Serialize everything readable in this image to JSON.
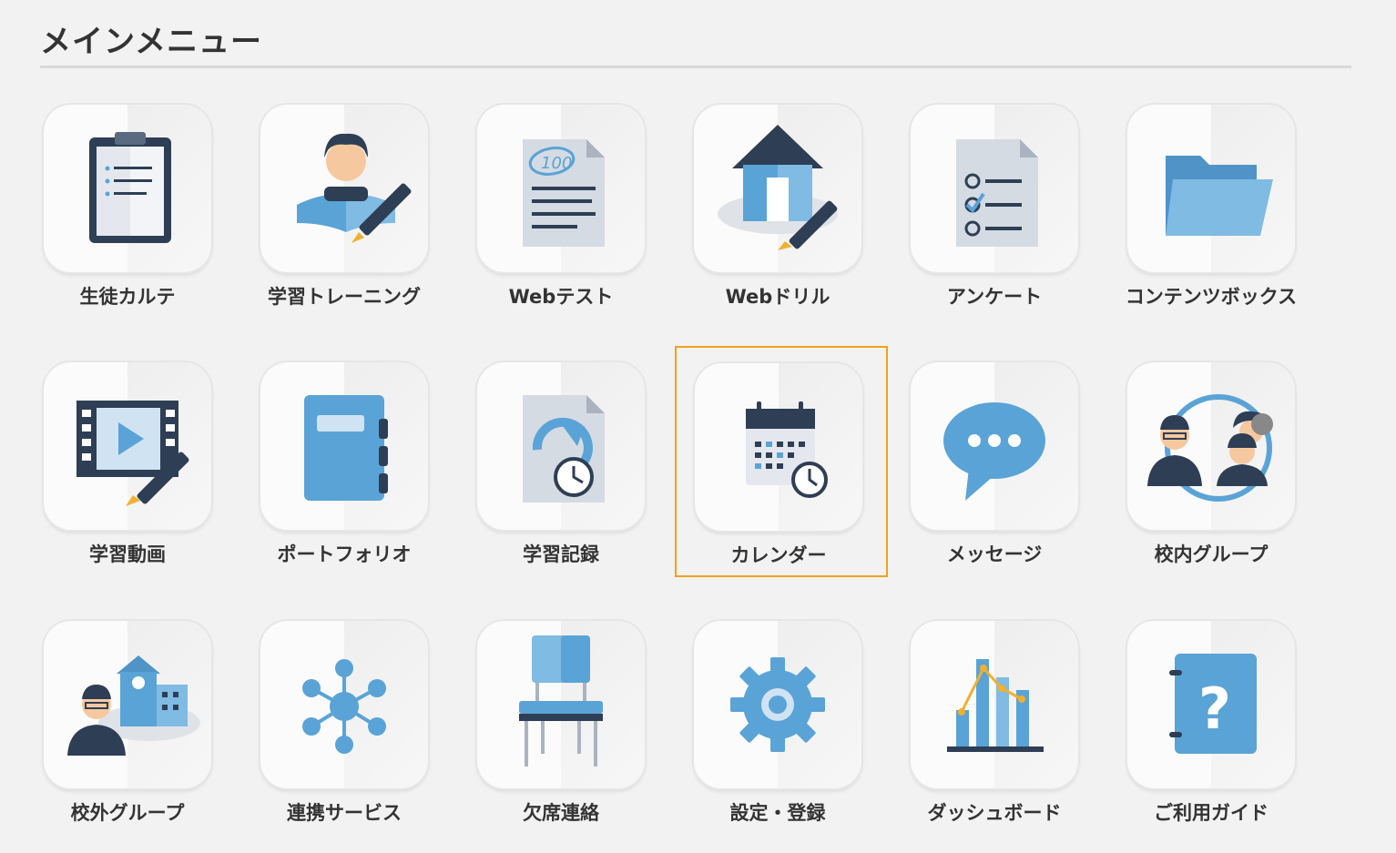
{
  "page": {
    "title": "メインメニュー"
  },
  "colors": {
    "accent_selected": "#f0a11e",
    "icon_blue": "#5aa3d6",
    "icon_dark": "#2e3e55"
  },
  "menu": [
    {
      "label": "生徒カルテ",
      "icon": "clipboard-icon"
    },
    {
      "label": "学習トレーニング",
      "icon": "student-reading-icon"
    },
    {
      "label": "Webテスト",
      "icon": "test-paper-icon"
    },
    {
      "label": "Webドリル",
      "icon": "house-pencil-icon"
    },
    {
      "label": "アンケート",
      "icon": "survey-checklist-icon"
    },
    {
      "label": "コンテンツボックス",
      "icon": "folder-icon"
    },
    {
      "label": "学習動画",
      "icon": "video-film-icon"
    },
    {
      "label": "ポートフォリオ",
      "icon": "notebook-icon"
    },
    {
      "label": "学習記録",
      "icon": "history-document-icon"
    },
    {
      "label": "カレンダー",
      "icon": "calendar-clock-icon",
      "selected": true
    },
    {
      "label": "メッセージ",
      "icon": "speech-bubble-icon"
    },
    {
      "label": "校内グループ",
      "icon": "people-group-icon"
    },
    {
      "label": "校外グループ",
      "icon": "school-teacher-icon"
    },
    {
      "label": "連携サービス",
      "icon": "network-hub-icon"
    },
    {
      "label": "欠席連絡",
      "icon": "chair-icon"
    },
    {
      "label": "設定・登録",
      "icon": "gear-icon"
    },
    {
      "label": "ダッシュボード",
      "icon": "bar-line-chart-icon"
    },
    {
      "label": "ご利用ガイド",
      "icon": "guide-book-question-icon"
    }
  ]
}
